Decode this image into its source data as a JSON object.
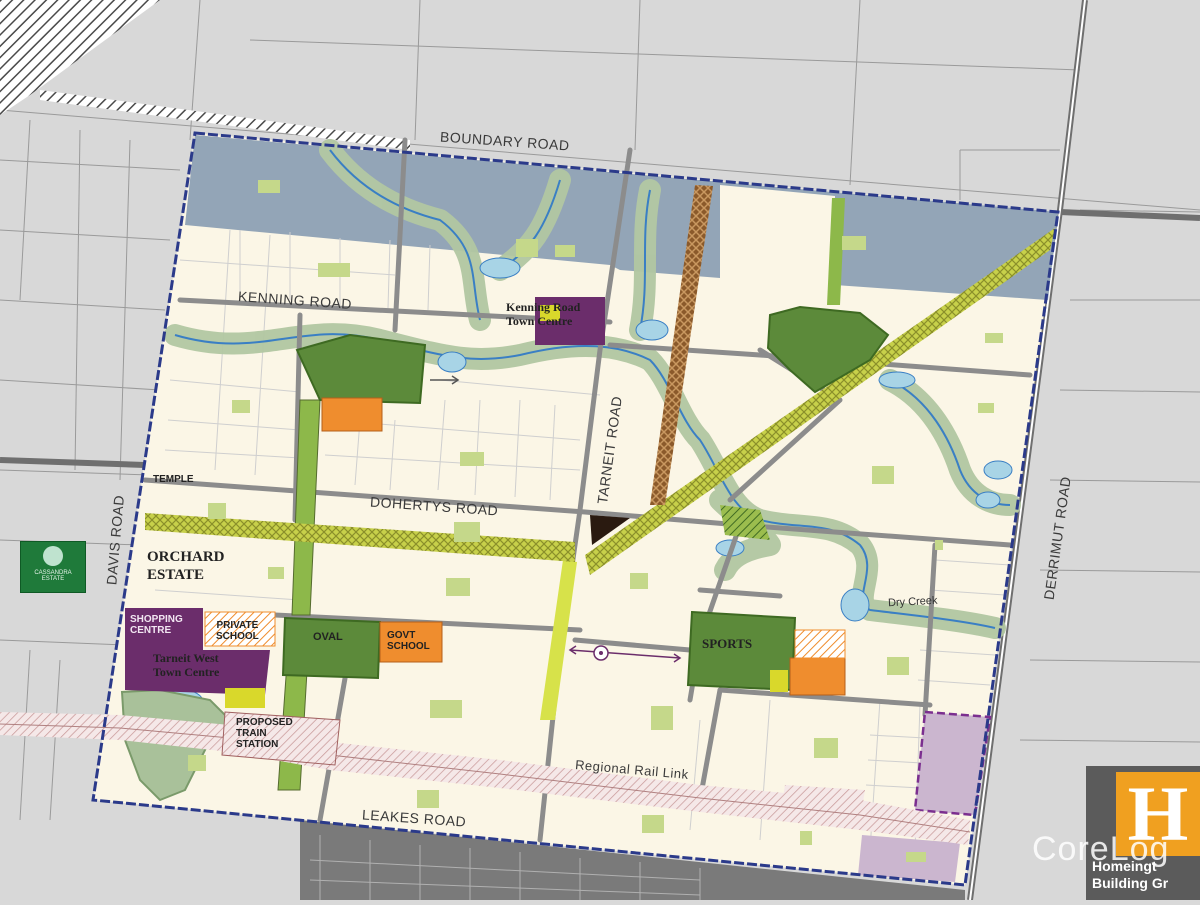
{
  "roads": {
    "boundary": "BOUNDARY ROAD",
    "kenning": "KENNING ROAD",
    "dohertys": "DOHERTYS ROAD",
    "tarneit": "TARNEIT ROAD",
    "davis": "DAVIS ROAD",
    "derrimut": "DERRIMUT ROAD",
    "leakes": "LEAKES ROAD",
    "regional_rail": "Regional Rail Link"
  },
  "places": {
    "kenning_town_centre": "Kenning Road\nTown Centre",
    "temple": "TEMPLE",
    "orchard_estate": "ORCHARD\nESTATE",
    "shopping_centre": "SHOPPING\nCENTRE",
    "private_school": "PRIVATE\nSCHOOL",
    "oval": "OVAL",
    "govt_school": "GOVT\nSCHOOL",
    "tarneit_west": "Tarneit West\nTown Centre",
    "train_station": "PROPOSED\nTRAIN\nSTATION",
    "sports": "SPORTS",
    "dry_creek": "Dry Creek"
  },
  "pin": {
    "label": "CASSANDRA\nESTATE"
  },
  "watermark": "CoreLog",
  "builder": {
    "logo": "H",
    "line1": "Homeingt",
    "line2": "Building Gr"
  },
  "colors": {
    "residential": "#fbf6e6",
    "industrial": "#95a5b5",
    "open_space": "#5c8a3a",
    "school": "#ef8d2e",
    "town_centre": "#6b2d6b",
    "road": "#8c8c8c",
    "creek": "#3a7fc4",
    "creek_buffer": "#a9c19a",
    "boundary": "#2b3a8a"
  }
}
